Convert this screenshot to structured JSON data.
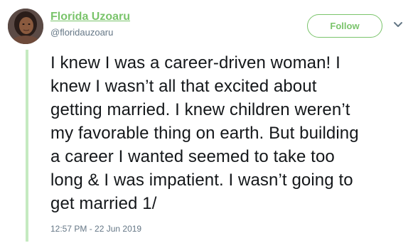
{
  "tweet": {
    "author": {
      "display_name": "Florida Uzoaru",
      "handle": "@floridauzoaru"
    },
    "follow_label": "Follow",
    "text": "I knew I was a career-driven woman! I\nknew I wasn’t all that excited about\ngetting married. I knew children weren’t\nmy favorable thing on earth. But building\na career I wanted seemed to take too\nlong & I was impatient. I wasn’t going to\nget married 1/",
    "timestamp": "12:57 PM - 22 Jun 2019"
  },
  "colors": {
    "accent": "#7ac46b",
    "thread_line": "#c5eac0",
    "text_primary": "#14171a",
    "text_secondary": "#657786"
  },
  "icons": {
    "menu": "chevron-down-icon"
  }
}
